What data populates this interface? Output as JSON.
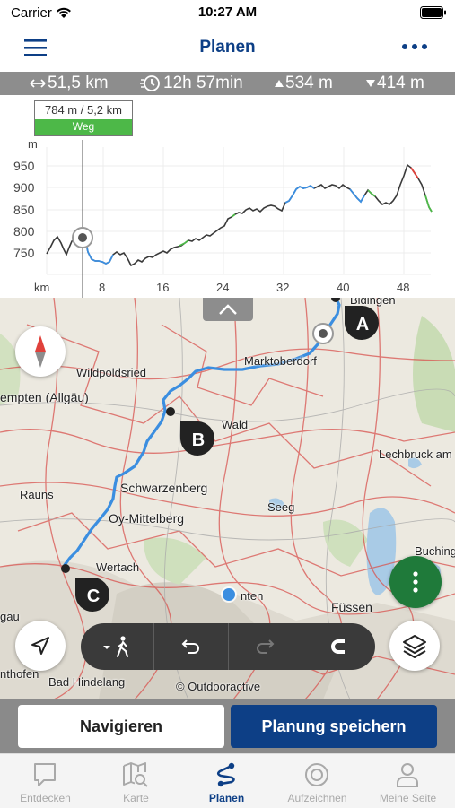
{
  "status": {
    "carrier": "Carrier",
    "time": "10:27 AM"
  },
  "header": {
    "title": "Planen"
  },
  "stats": {
    "distance": "51,5 km",
    "duration": "12h 57min",
    "ascent": "534 m",
    "descent": "414 m"
  },
  "elevation": {
    "tooltip_value": "784 m / 5,2 km",
    "tooltip_surface": "Weg",
    "unit_y": "m",
    "unit_x": "km",
    "y_ticks": [
      "950",
      "900",
      "850",
      "800",
      "750"
    ],
    "x_ticks": [
      "8",
      "16",
      "24",
      "32",
      "40",
      "48"
    ]
  },
  "map": {
    "labels": {
      "bidingen": "Bidingen",
      "marktoberdorf": "Marktoberdorf",
      "wildpoldsried": "Wildpoldsried",
      "kempten": "empten (Allgäu)",
      "wald": "Wald",
      "lechbruck": "Lechbruck am S",
      "schwarzenberg": "Schwarzenberg",
      "rauns": "Rauns",
      "seeg": "Seeg",
      "oy_mittelberg": "Oy-Mittelberg",
      "buching": "Buching",
      "wertach": "Wertach",
      "fuessen": "Füssen",
      "nten": "nten",
      "gau": "gäu",
      "nthofen": "nthofen",
      "bad_hindelang": "Bad Hindelang",
      "attribution": "© Outdooractive"
    },
    "waypoints": [
      "A",
      "B",
      "C"
    ]
  },
  "actions": {
    "navigate": "Navigieren",
    "save": "Planung speichern"
  },
  "tabs": [
    {
      "label": "Entdecken"
    },
    {
      "label": "Karte"
    },
    {
      "label": "Planen"
    },
    {
      "label": "Aufzeichnen"
    },
    {
      "label": "Meine Seite"
    }
  ],
  "colors": {
    "brand": "#0d3f86",
    "route": "#3b8ee0",
    "surface_weg": "#4db848",
    "fab_green": "#1f7a3a"
  }
}
